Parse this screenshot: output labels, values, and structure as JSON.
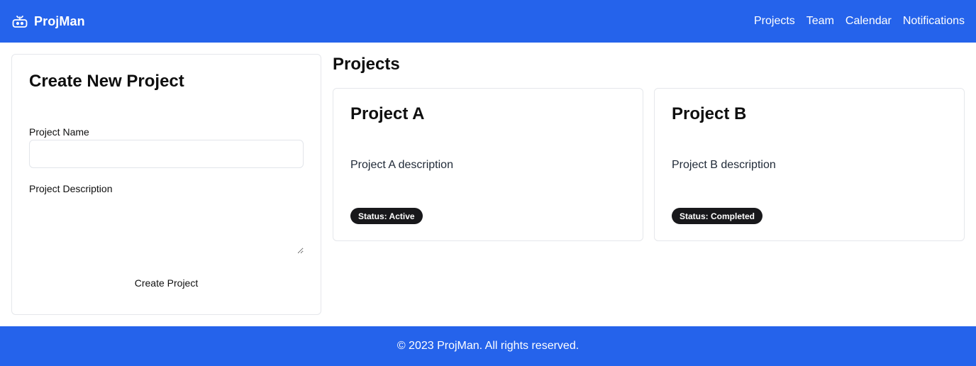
{
  "header": {
    "brand": "ProjMan",
    "brand_icon": "robot-icon",
    "nav": [
      "Projects",
      "Team",
      "Calendar",
      "Notifications"
    ]
  },
  "create_form": {
    "title": "Create New Project",
    "name_label": "Project Name",
    "name_value": "",
    "description_label": "Project Description",
    "description_value": "",
    "submit_label": "Create Project"
  },
  "projects": {
    "title": "Projects",
    "items": [
      {
        "name": "Project A",
        "description": "Project A description",
        "status": "Status: Active"
      },
      {
        "name": "Project B",
        "description": "Project B description",
        "status": "Status: Completed"
      }
    ]
  },
  "footer": {
    "text": "© 2023 ProjMan. All rights reserved."
  },
  "colors": {
    "primary": "#2563eb",
    "badge": "#18181b"
  }
}
